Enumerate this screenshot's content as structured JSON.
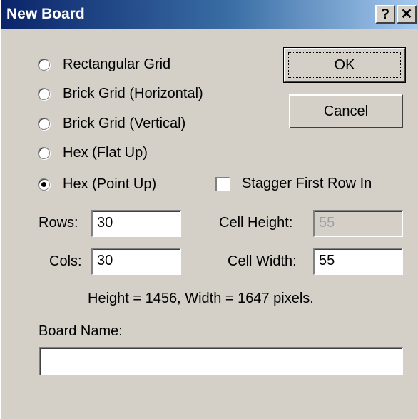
{
  "window": {
    "title": "New Board",
    "help_glyph": "?",
    "close_glyph": "✕"
  },
  "grid_types": [
    {
      "label": "Rectangular Grid",
      "selected": false
    },
    {
      "label": "Brick Grid (Horizontal)",
      "selected": false
    },
    {
      "label": "Brick Grid (Vertical)",
      "selected": false
    },
    {
      "label": "Hex (Flat Up)",
      "selected": false
    },
    {
      "label": "Hex (Point Up)",
      "selected": true
    }
  ],
  "buttons": {
    "ok_label": "OK",
    "cancel_label": "Cancel"
  },
  "stagger": {
    "label": "Stagger First Row In",
    "checked": false
  },
  "fields": {
    "rows_label": "Rows:",
    "rows_value": "30",
    "cols_label": "Cols:",
    "cols_value": "30",
    "cell_height_label": "Cell Height:",
    "cell_height_value": "55",
    "cell_width_label": "Cell Width:",
    "cell_width_value": "55"
  },
  "summary": "Height = 1456, Width = 1647 pixels.",
  "board_name": {
    "label": "Board Name:",
    "value": ""
  }
}
